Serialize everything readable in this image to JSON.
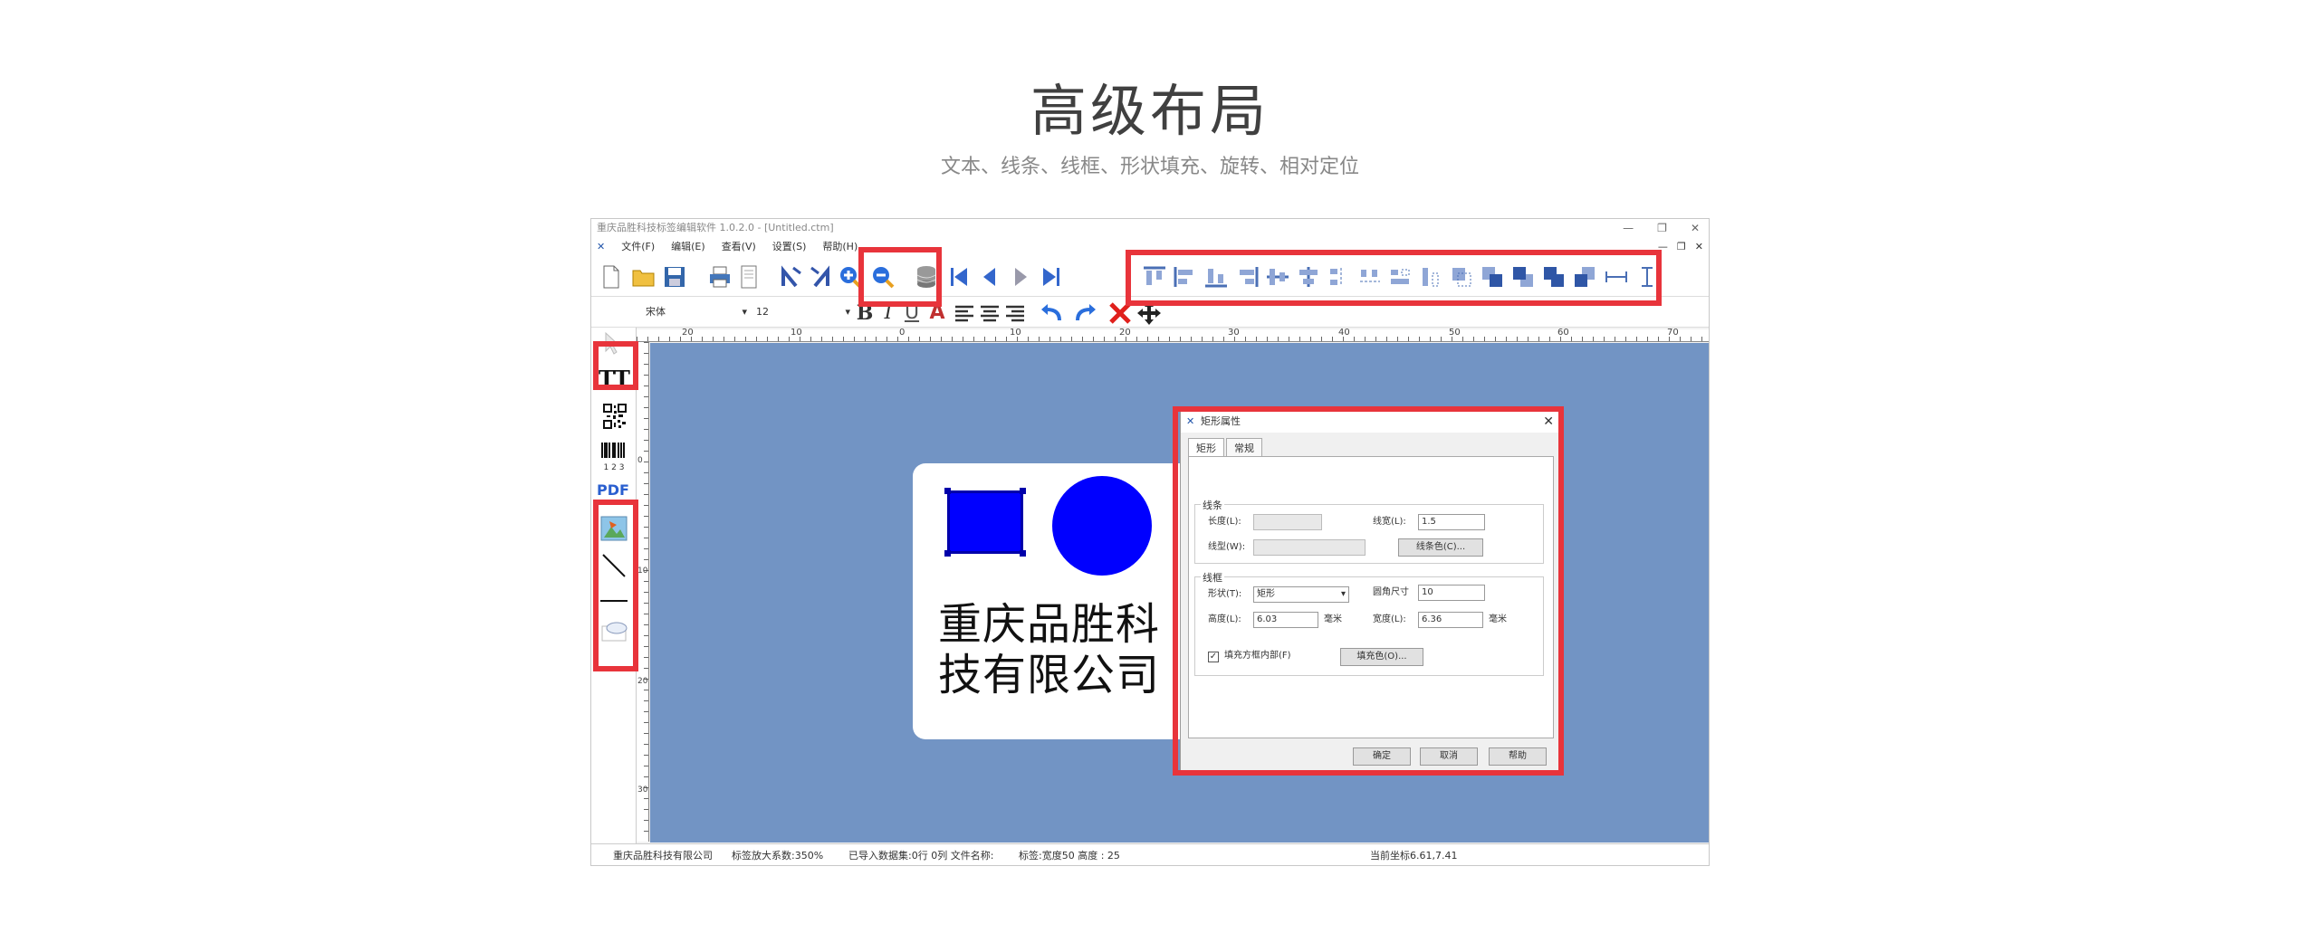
{
  "header": {
    "title": "高级布局",
    "subtitle": "文本、线条、线框、形状填充、旋转、相对定位"
  },
  "window": {
    "title": "重庆品胜科技标签编辑软件   1.0.2.0 - [Untitled.ctm]",
    "controls": [
      "—",
      "❐",
      "✕"
    ]
  },
  "menu": [
    "文件(F)",
    "编辑(E)",
    "查看(V)",
    "设置(S)",
    "帮助(H)"
  ],
  "mdi_controls": [
    "—",
    "❐",
    "✕"
  ],
  "font_toolbar": {
    "font_name": "宋体",
    "font_size": "12",
    "bold": "B",
    "italic": "I",
    "underline": "U",
    "font_color": "A"
  },
  "ruler": {
    "h_ticks": [
      "20",
      "10",
      "0",
      "10",
      "20",
      "30",
      "40",
      "50",
      "60",
      "70"
    ],
    "v_ticks": [
      "0",
      "10",
      "20",
      "30"
    ]
  },
  "label": {
    "text_line1": "重庆品胜科",
    "text_line2": "技有限公司"
  },
  "left_tools": {
    "text_tool": "TT",
    "pdf_tool": "PDF",
    "barcode_digits": "1 2 3"
  },
  "dialog": {
    "title": "矩形属性",
    "tabs": [
      "矩形",
      "常规"
    ],
    "line_group": "线条",
    "length_label": "长度(L):",
    "line_width_label": "线宽(L):",
    "line_width_value": "1.5",
    "line_type_label": "线型(W):",
    "line_color_button": "线条色(C)...",
    "shape_group": "线框",
    "shape_label": "形状(T):",
    "shape_value": "矩形",
    "corner_label": "圆角尺寸",
    "corner_value": "10",
    "height_label": "高度(L):",
    "height_value": "6.03",
    "width_label": "宽度(L):",
    "width_value": "6.36",
    "unit": "毫米",
    "fill_checkbox_label": "填充方框内部(F)",
    "fill_color_button": "填充色(O)...",
    "ok": "确定",
    "cancel": "取消",
    "help": "帮助"
  },
  "status": {
    "company": "重庆品胜科技有限公司",
    "zoom": "标签放大系数:350%",
    "data": "已导入数据集:0行 0列 文件名称:",
    "size": "标签:宽度50 高度 : 25",
    "coords": "当前坐标6.61,7.41"
  },
  "colors": {
    "highlight": "#e8343b",
    "canvas": "#7294c4",
    "shape_fill": "#0000ff",
    "toolbar_icon": "#3355aa"
  }
}
